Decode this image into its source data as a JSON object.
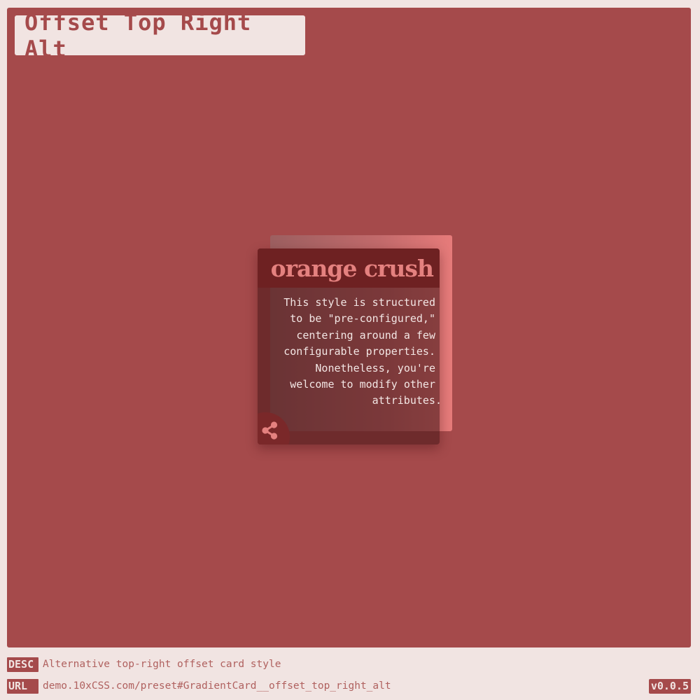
{
  "page": {
    "title": "Offset Top Right Alt"
  },
  "card": {
    "title": "orange crush",
    "body_lines": [
      "This style is structured",
      "to be \"pre-configured,\"",
      "centering around a few",
      "configurable properties.",
      "Nonetheless, you're",
      "welcome to modify other",
      "attributes."
    ],
    "share_icon": "share-icon"
  },
  "footer": {
    "desc_label": "DESC",
    "desc_text": "Alternative top-right offset card style",
    "url_label": "URL",
    "url_text": "demo.10xCSS.com/preset#GradientCard__offset_top_right_alt",
    "version": "v0.0.5"
  },
  "colors": {
    "page_background": "#f1e4e2",
    "stage_background": "#a54a4b",
    "card_header": "#6e2122",
    "card_title": "#e4817f",
    "accent_gradient_end": "#e67b7a"
  }
}
